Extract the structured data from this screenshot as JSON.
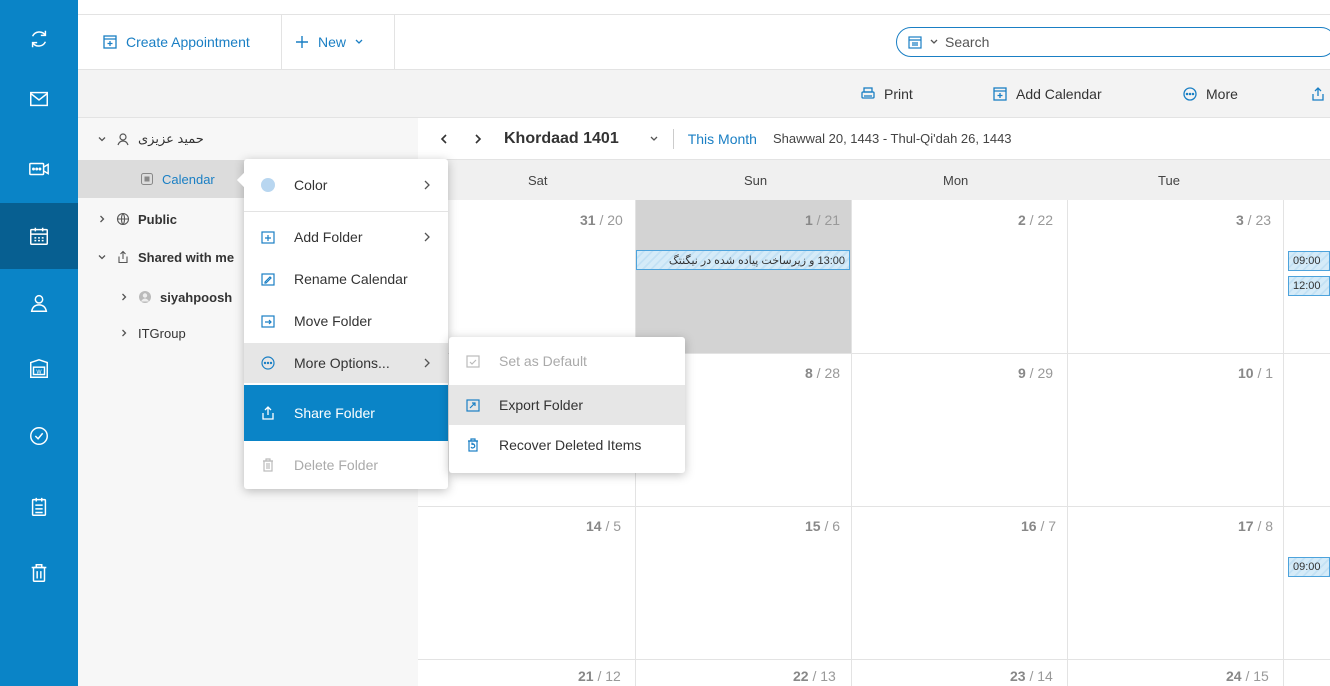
{
  "toolbar": {
    "create_appointment": "Create Appointment",
    "new": "New",
    "search_placeholder": "Search"
  },
  "actions": {
    "print": "Print",
    "add_calendar": "Add Calendar",
    "more": "More"
  },
  "sidebar": {
    "user_name": "حمید عزیزی",
    "calendar": "Calendar",
    "public": "Public",
    "shared_with_me": "Shared with me",
    "siyahpoosh": "siyahpoosh",
    "itgroup": "ITGroup"
  },
  "calendar": {
    "month_title": "Khordaad 1401",
    "this_month": "This Month",
    "hijri_range": "Shawwal 20, 1443 - Thul-Qi'dah 26, 1443",
    "day_names": [
      "Sat",
      "Sun",
      "Mon",
      "Tue"
    ],
    "weeks": [
      [
        {
          "g": "31",
          "h": "20"
        },
        {
          "g": "1",
          "h": "21"
        },
        {
          "g": "2",
          "h": "22"
        },
        {
          "g": "3",
          "h": "23"
        }
      ],
      [
        {
          "g": "",
          "h": ""
        },
        {
          "g": "8",
          "h": "28"
        },
        {
          "g": "9",
          "h": "29"
        },
        {
          "g": "10",
          "h": "1"
        }
      ],
      [
        {
          "g": "14",
          "h": "5"
        },
        {
          "g": "15",
          "h": "6"
        },
        {
          "g": "16",
          "h": "7"
        },
        {
          "g": "17",
          "h": "8"
        }
      ],
      [
        {
          "g": "21",
          "h": "12"
        },
        {
          "g": "22",
          "h": "13"
        },
        {
          "g": "23",
          "h": "14"
        },
        {
          "g": "24",
          "h": "15"
        }
      ]
    ],
    "events": {
      "sun_event": "13:00 و زیرساخت پیاده شده در نیگنتگ",
      "tue_event_1": "09:00",
      "tue_event_2": "12:00",
      "tue_event_3": "09:00"
    }
  },
  "context_menu": {
    "color": "Color",
    "add_folder": "Add Folder",
    "rename_calendar": "Rename Calendar",
    "move_folder": "Move Folder",
    "more_options": "More Options...",
    "share_folder": "Share Folder",
    "delete_folder": "Delete Folder"
  },
  "submenu": {
    "set_as_default": "Set as Default",
    "export_folder": "Export Folder",
    "recover_deleted_items": "Recover Deleted Items"
  },
  "colors": {
    "rail": "#0a84c7",
    "rail_active": "#075f91",
    "accent": "#1a7fc4"
  }
}
